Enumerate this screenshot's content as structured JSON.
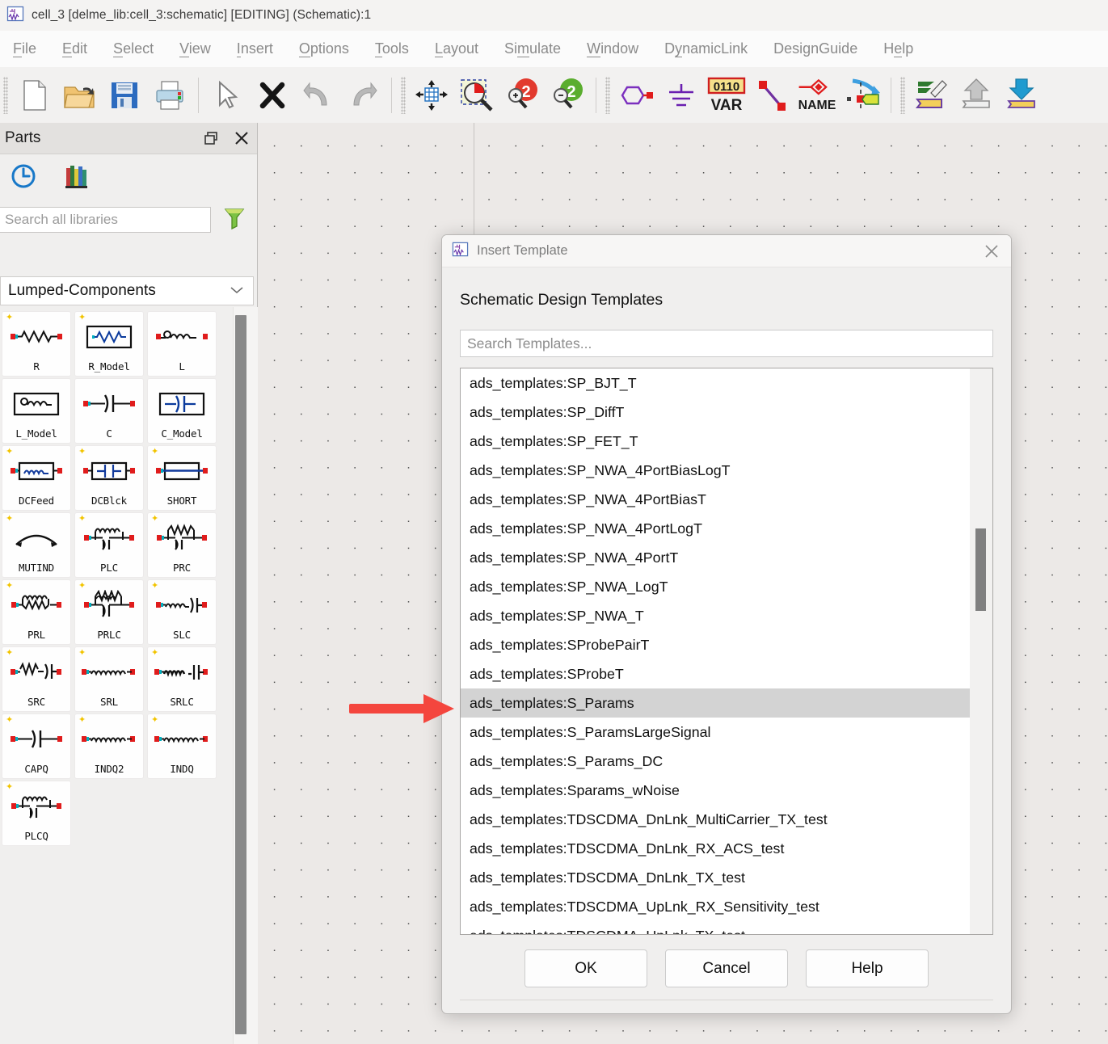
{
  "titlebar": {
    "icon": "schematic-icon",
    "text": "cell_3 [delme_lib:cell_3:schematic] [EDITING] (Schematic):1"
  },
  "menubar": {
    "items": [
      {
        "pre": "",
        "mn": "F",
        "post": "ile"
      },
      {
        "pre": "",
        "mn": "E",
        "post": "dit"
      },
      {
        "pre": "",
        "mn": "S",
        "post": "elect"
      },
      {
        "pre": "",
        "mn": "V",
        "post": "iew"
      },
      {
        "pre": "",
        "mn": "I",
        "post": "nsert"
      },
      {
        "pre": "",
        "mn": "O",
        "post": "ptions"
      },
      {
        "pre": "",
        "mn": "T",
        "post": "ools"
      },
      {
        "pre": "",
        "mn": "L",
        "post": "ayout"
      },
      {
        "pre": "Si",
        "mn": "m",
        "post": "ulate"
      },
      {
        "pre": "",
        "mn": "W",
        "post": "indow"
      },
      {
        "pre": "D",
        "mn": "y",
        "post": "namicLink"
      },
      {
        "pre": "DesignGuide",
        "mn": "",
        "post": ""
      },
      {
        "pre": "H",
        "mn": "e",
        "post": "lp"
      }
    ]
  },
  "toolbar": {
    "icons": [
      "new-file-icon",
      "open-folder-icon",
      "save-icon",
      "print-icon",
      "select-arrow-icon",
      "delete-x-icon",
      "undo-icon",
      "redo-icon",
      "pan-move-icon",
      "zoom-area-icon",
      "zoom-in-icon",
      "zoom-out-icon",
      "port-icon",
      "ground-icon",
      "var-icon",
      "wire-icon",
      "name-wire-icon",
      "wire-label-icon",
      "edit-layout-icon",
      "push-up-icon",
      "pull-down-icon"
    ]
  },
  "parts": {
    "title": "Parts",
    "restore_label": "restore",
    "close_label": "close",
    "history_icon": "clock-history-icon",
    "library_icon": "library-books-icon",
    "search_placeholder": "Search all libraries",
    "filter_icon": "funnel-filter-icon",
    "category": "Lumped-Components",
    "items": [
      {
        "label": "R",
        "sym": "res",
        "star": true
      },
      {
        "label": "R_Model",
        "sym": "res-box",
        "star": true
      },
      {
        "label": "L",
        "sym": "ind",
        "star": false
      },
      {
        "label": "L_Model",
        "sym": "ind-box",
        "star": false
      },
      {
        "label": "C",
        "sym": "cap",
        "star": false
      },
      {
        "label": "C_Model",
        "sym": "cap-box",
        "star": false
      },
      {
        "label": "DCFeed",
        "sym": "ind-box2",
        "star": true
      },
      {
        "label": "DCBlck",
        "sym": "cap-box2",
        "star": true
      },
      {
        "label": "SHORT",
        "sym": "short",
        "star": true
      },
      {
        "label": "MUTIND",
        "sym": "mutind",
        "star": true
      },
      {
        "label": "PLC",
        "sym": "plc",
        "star": true
      },
      {
        "label": "PRC",
        "sym": "prc",
        "star": true
      },
      {
        "label": "PRL",
        "sym": "prl",
        "star": true
      },
      {
        "label": "PRLC",
        "sym": "prlc",
        "star": true
      },
      {
        "label": "SLC",
        "sym": "slc",
        "star": true
      },
      {
        "label": "SRC",
        "sym": "src",
        "star": true
      },
      {
        "label": "SRL",
        "sym": "srl",
        "star": true
      },
      {
        "label": "SRLC",
        "sym": "srlc",
        "star": true
      },
      {
        "label": "CAPQ",
        "sym": "cap",
        "star": true
      },
      {
        "label": "INDQ2",
        "sym": "srl",
        "star": true
      },
      {
        "label": "INDQ",
        "sym": "srl",
        "star": true
      },
      {
        "label": "PLCQ",
        "sym": "plc",
        "star": true
      }
    ]
  },
  "dialog": {
    "icon": "schematic-icon",
    "title": "Insert Template",
    "close_label": "close",
    "heading": "Schematic Design Templates",
    "search_placeholder": "Search Templates...",
    "list": [
      {
        "label": "ads_templates:SP_BJT_T",
        "selected": false
      },
      {
        "label": "ads_templates:SP_DiffT",
        "selected": false
      },
      {
        "label": "ads_templates:SP_FET_T",
        "selected": false
      },
      {
        "label": "ads_templates:SP_NWA_4PortBiasLogT",
        "selected": false
      },
      {
        "label": "ads_templates:SP_NWA_4PortBiasT",
        "selected": false
      },
      {
        "label": "ads_templates:SP_NWA_4PortLogT",
        "selected": false
      },
      {
        "label": "ads_templates:SP_NWA_4PortT",
        "selected": false
      },
      {
        "label": "ads_templates:SP_NWA_LogT",
        "selected": false
      },
      {
        "label": "ads_templates:SP_NWA_T",
        "selected": false
      },
      {
        "label": "ads_templates:SProbePairT",
        "selected": false
      },
      {
        "label": "ads_templates:SProbeT",
        "selected": false
      },
      {
        "label": "ads_templates:S_Params",
        "selected": true
      },
      {
        "label": "ads_templates:S_ParamsLargeSignal",
        "selected": false
      },
      {
        "label": "ads_templates:S_Params_DC",
        "selected": false
      },
      {
        "label": "ads_templates:Sparams_wNoise",
        "selected": false
      },
      {
        "label": "ads_templates:TDSCDMA_DnLnk_MultiCarrier_TX_test",
        "selected": false
      },
      {
        "label": "ads_templates:TDSCDMA_DnLnk_RX_ACS_test",
        "selected": false
      },
      {
        "label": "ads_templates:TDSCDMA_DnLnk_TX_test",
        "selected": false
      },
      {
        "label": "ads_templates:TDSCDMA_UpLnk_RX_Sensitivity_test",
        "selected": false
      },
      {
        "label": "ads_templates:TDSCDMA_UpLnk_TX_test",
        "selected": false
      }
    ],
    "buttons": {
      "ok": "OK",
      "cancel": "Cancel",
      "help": "Help"
    }
  },
  "annotation": {
    "arrow_icon": "pointer-arrow-icon",
    "arrow_color": "#F4463E"
  },
  "colors": {
    "accent": "#F4463E",
    "selection": "#d3d3d3",
    "canvas": "#ece9e7"
  }
}
